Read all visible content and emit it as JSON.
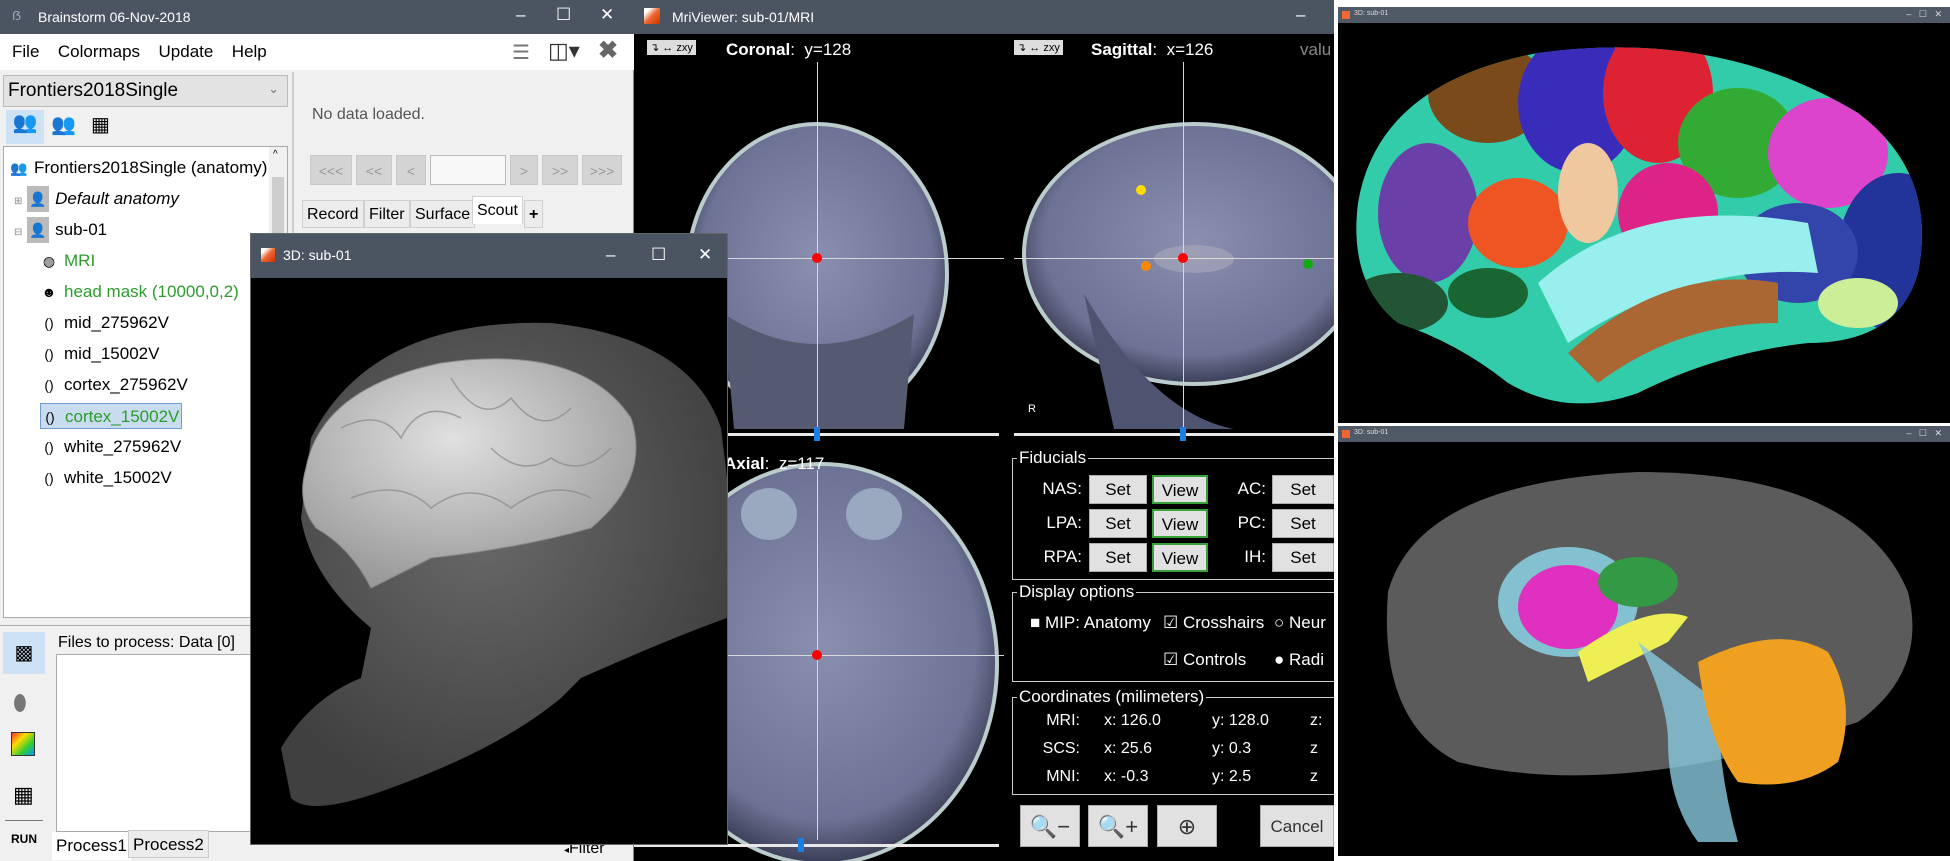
{
  "brainstorm": {
    "title": "Brainstorm 06-Nov-2018",
    "menu": [
      "File",
      "Colormaps",
      "Update",
      "Help"
    ],
    "protocol": "Frontiers2018Single",
    "no_data": "No data loaded.",
    "nav_buttons": [
      "<<<",
      "<<",
      "<",
      ">",
      ">>",
      ">>>"
    ],
    "nav_input": "",
    "tabs": [
      "Record",
      "Filter",
      "Surface",
      "Scout",
      "+"
    ],
    "active_tab": "Scout",
    "tree": {
      "root": "Frontiers2018Single (anatomy)",
      "default_anatomy": "Default anatomy",
      "subject": "sub-01",
      "items": [
        {
          "label": "MRI",
          "icon": "mri-icon",
          "color": "green"
        },
        {
          "label": "head mask (10000,0,2)",
          "icon": "head-icon",
          "color": "green"
        },
        {
          "label": "mid_275962V",
          "icon": "surface-icon"
        },
        {
          "label": "mid_15002V",
          "icon": "surface-icon"
        },
        {
          "label": "cortex_275962V",
          "icon": "surface-icon"
        },
        {
          "label": "cortex_15002V",
          "icon": "surface-icon",
          "color": "green",
          "selected": true
        },
        {
          "label": "white_275962V",
          "icon": "surface-icon"
        },
        {
          "label": "white_15002V",
          "icon": "surface-icon"
        }
      ]
    },
    "process": {
      "files_label": "Files to process: Data [0]",
      "run_label": "RUN",
      "tabs": [
        "Process1",
        "Process2"
      ],
      "filter_label": "Filter"
    }
  },
  "window_3d": {
    "title": "3D: sub-01"
  },
  "mri_viewer": {
    "title": "MriViewer: sub-01/MRI",
    "coronal": {
      "name": "Coronal",
      "coord": "y=128"
    },
    "sagittal": {
      "name": "Sagittal",
      "coord": "x=126"
    },
    "axial": {
      "name": "Axial",
      "coord": "z=117"
    },
    "value_label": "valu",
    "orient_label": "R",
    "fiducials": {
      "title": "Fiducials",
      "rows": [
        {
          "label": "NAS:",
          "set": "Set",
          "view": "View",
          "label2": "AC:",
          "set2": "Set"
        },
        {
          "label": "LPA:",
          "set": "Set",
          "view": "View",
          "label2": "PC:",
          "set2": "Set"
        },
        {
          "label": "RPA:",
          "set": "Set",
          "view": "View",
          "label2": "IH:",
          "set2": "Set"
        }
      ]
    },
    "display_options": {
      "title": "Display options",
      "mip": {
        "label": "MIP: Anatomy",
        "checked": false
      },
      "crosshairs": {
        "label": "Crosshairs",
        "checked": true
      },
      "controls": {
        "label": "Controls",
        "checked": true
      },
      "neuro": {
        "label": "Neur",
        "selected": false
      },
      "radio": {
        "label": "Radi",
        "selected": true
      }
    },
    "coordinates": {
      "title": "Coordinates (milimeters)",
      "rows": [
        {
          "label": "MRI:",
          "x": "x: 126.0",
          "y": "y: 128.0",
          "z": "z:"
        },
        {
          "label": "SCS:",
          "x": "x: 25.6",
          "y": "y: 0.3",
          "z": "z"
        },
        {
          "label": "MNI:",
          "x": "x: -0.3",
          "y": "y: 2.5",
          "z": "z"
        }
      ]
    },
    "cancel": "Cancel"
  },
  "right_windows": [
    {
      "title": "3D: sub-01"
    },
    {
      "title": "3D: sub-01"
    }
  ],
  "colors": {
    "titlebar": "#4b5562",
    "accent": "#1a7fe0",
    "crosshair_dot": "#ff0000",
    "selected_green": "#2a9d2a"
  }
}
